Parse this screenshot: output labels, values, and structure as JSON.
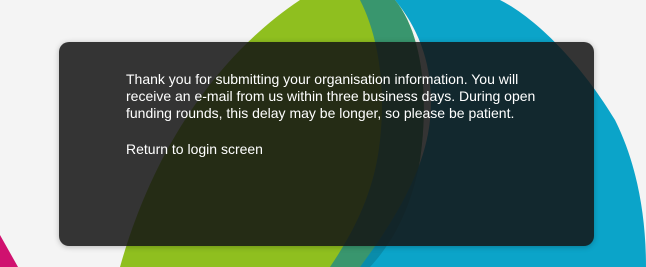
{
  "background": {
    "colors": {
      "base": "#f4f4f4",
      "lime": "#8fbf1f",
      "teal": "#0ba4c9",
      "magenta": "#d0116f",
      "modal": "#141414"
    }
  },
  "dialog": {
    "message": "Thank you for submitting your organisation information. You will receive an e-mail from us within three business days. During open funding rounds, this delay may be longer, so please be patient.",
    "return_link_label": "Return to login screen"
  }
}
